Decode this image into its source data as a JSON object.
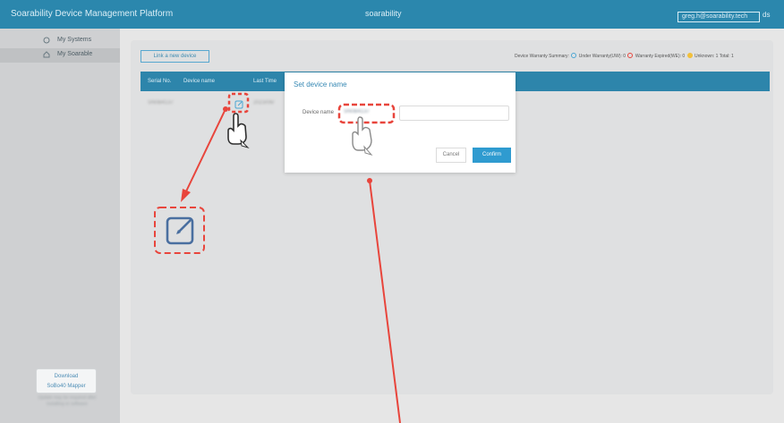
{
  "topbar": {
    "app_title": "Soarability Device Management Platform",
    "center_title": "soarability",
    "user_email": "greg.h@soarability.tech",
    "user_extra": "ds"
  },
  "sidebar": {
    "items": [
      {
        "label": "My Systems",
        "icon": "systems-icon"
      },
      {
        "label": "My Soarable",
        "icon": "home-icon"
      }
    ],
    "download_label_1": "Download",
    "download_label_2": "SoBo40 Mapper",
    "download_note": "Update may be required after installing or software"
  },
  "main": {
    "add_button_label": "Link a new device",
    "summary": {
      "text_prefix": "Device Warranty Summary:",
      "under_warranty": "Under Warranty(UW): 0",
      "expired": "Warranty Expired(WE): 0",
      "unknown": "Unknown: 1",
      "total": "Total: 1"
    },
    "table": {
      "headers": [
        "Serial No.",
        "Device name",
        "Last Time"
      ],
      "row_serial": "SN0B4137",
      "row_lasttime": "2023/06/"
    }
  },
  "modal": {
    "title": "Set device name",
    "field_label": "Device name",
    "field_current_value": "SN0B4137",
    "input_value": "",
    "cancel_label": "Cancel",
    "confirm_label": "Confirm"
  },
  "colors": {
    "accent": "#2b87ad",
    "annotation_red": "#e8453c",
    "confirm_blue": "#2f9bd0"
  }
}
